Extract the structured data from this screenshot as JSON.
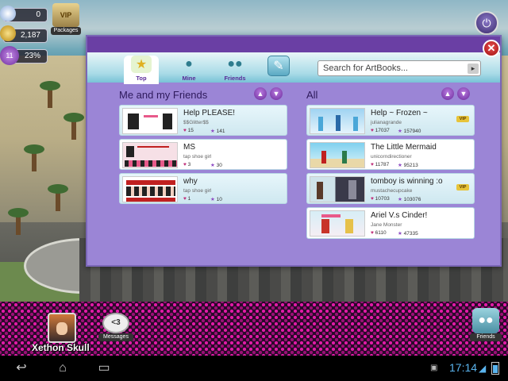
{
  "hud": {
    "gems": "0",
    "coins": "2,187",
    "level": "11",
    "level_progress": "23%",
    "packages_label": "Packages",
    "vip_label": "VIP"
  },
  "dialog": {
    "tabs": [
      {
        "label": "Top",
        "icon": "star-icon"
      },
      {
        "label": "Mine",
        "icon": "person-icon"
      },
      {
        "label": "Friends",
        "icon": "friends-icon"
      },
      {
        "label": "",
        "icon": "brush-add-icon"
      }
    ],
    "search_placeholder": "Search for ArtBooks...",
    "friends_title": "Me and my Friends",
    "all_title": "All",
    "friends_books": [
      {
        "title": "Help PLEASE!",
        "author": "$$Glitter$$",
        "likes": "15",
        "stars": "141"
      },
      {
        "title": "MS",
        "author": "tap shoe girl",
        "likes": "3",
        "stars": "30"
      },
      {
        "title": "why",
        "author": "tap shoe girl",
        "likes": "1",
        "stars": "10"
      }
    ],
    "all_books": [
      {
        "title": "Help ~ Frozen ~",
        "author": "julianagrande",
        "likes": "17037",
        "stars": "157940",
        "vip": "VIP"
      },
      {
        "title": "The Little Mermaid",
        "author": "unicorndirectioner",
        "likes": "11787",
        "stars": "95213"
      },
      {
        "title": "tomboy is winning :o",
        "author": "mustachecupcake",
        "likes": "10703",
        "stars": "103076",
        "vip": "VIP"
      },
      {
        "title": "Ariel V.s Cinder!",
        "author": "Jane Monster",
        "likes": "6110",
        "stars": "47335"
      }
    ]
  },
  "bottom": {
    "username": "Xethon Skull",
    "messages_label": "Messages",
    "messages_badge": "<3",
    "friends_label": "Friends"
  },
  "system": {
    "time": "17:14"
  },
  "colors": {
    "accent_purple": "#6a3fa4",
    "panel_lavender": "#9b85d6",
    "heart_pink": "#c0307a",
    "star_purple": "#8e4bc4",
    "clock_blue": "#5ab4ee"
  }
}
